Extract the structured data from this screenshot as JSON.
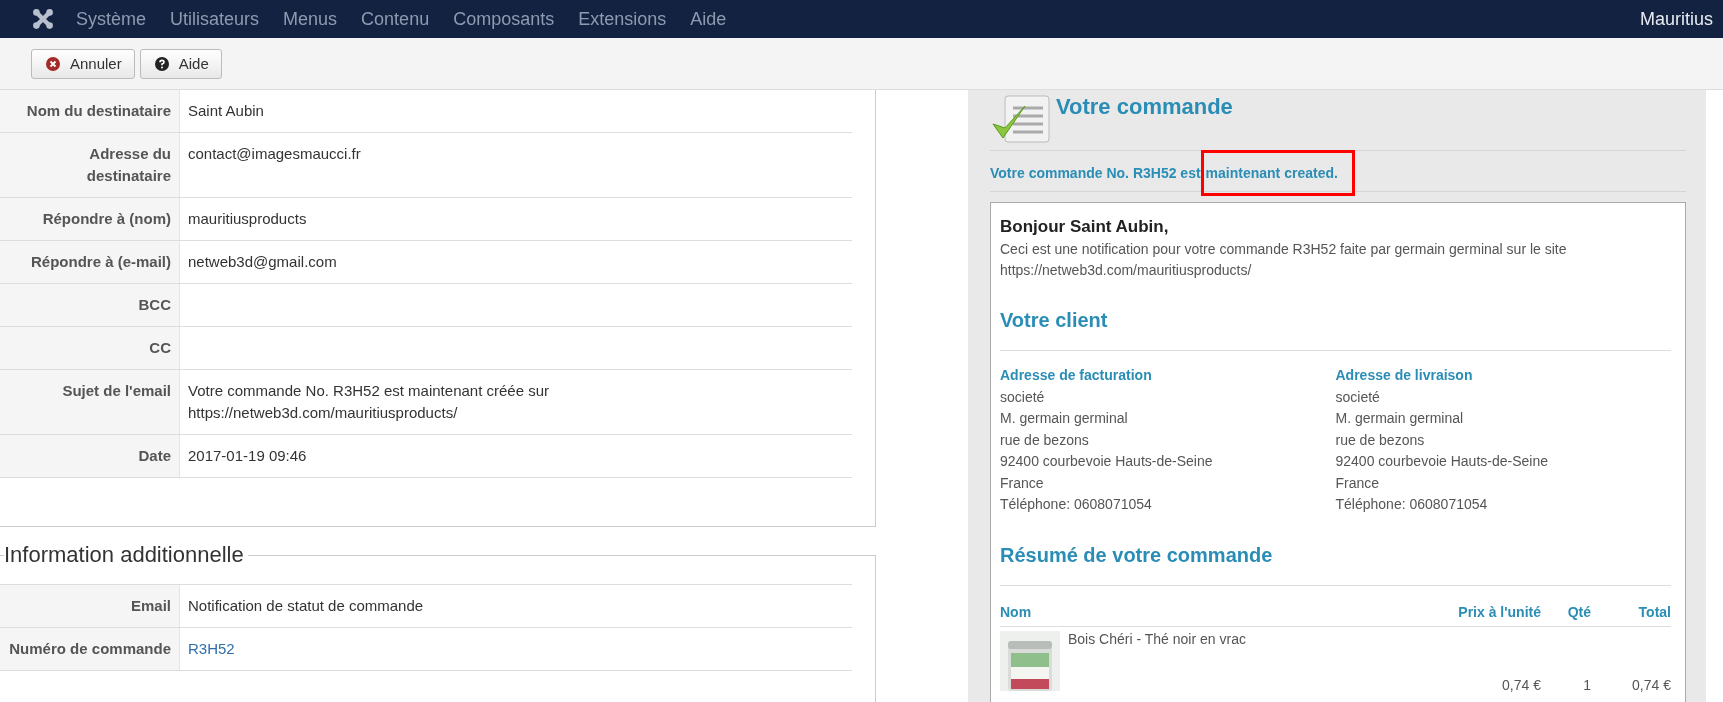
{
  "navbar": {
    "menu": [
      "Système",
      "Utilisateurs",
      "Menus",
      "Contenu",
      "Composants",
      "Extensions",
      "Aide"
    ],
    "site": "Mauritius"
  },
  "toolbar": {
    "buttons": [
      {
        "label": "Annuler",
        "kind": "cancel"
      },
      {
        "label": "Aide",
        "kind": "help"
      }
    ]
  },
  "details": {
    "rows": [
      {
        "label": "Nom du destinataire",
        "value": "Saint Aubin"
      },
      {
        "label": "Adresse du destinataire",
        "value": "contact@imagesmaucci.fr"
      },
      {
        "label": "Répondre à (nom)",
        "value": "mauritiusproducts"
      },
      {
        "label": "Répondre à (e-mail)",
        "value": "netweb3d@gmail.com"
      },
      {
        "label": "BCC"
      },
      {
        "label": "CC"
      },
      {
        "label": "Sujet de l'email",
        "value": "Votre commande No. R3H52 est maintenant créée sur https://netweb3d.com/mauritiusproducts/"
      },
      {
        "label": "Date",
        "value": "2017-01-19 09:46"
      }
    ]
  },
  "additional": {
    "legend": "Information additionnelle",
    "rows": [
      {
        "label": "Email",
        "value": "Notification de statut de commande",
        "kind": "text"
      },
      {
        "label": "Numéro de commande",
        "value": "R3H52",
        "kind": "link"
      }
    ]
  },
  "preview": {
    "title": "Votre commande",
    "message": "Votre commande No. R3H52 est",
    "message_highlighted": "maintenant created.",
    "email": {
      "greeting": "Bonjour Saint Aubin,",
      "intro": "Ceci est une notification pour votre commande R3H52 faite par germain germinal sur le site https://netweb3d.com/mauritiusproducts/",
      "client_heading": "Votre client",
      "addresses": [
        {
          "heading": "Adresse de facturation",
          "lines": [
            "societé",
            "M. germain germinal",
            "rue de bezons",
            "92400 courbevoie Hauts-de-Seine",
            "France",
            "Téléphone: 0608071054"
          ]
        },
        {
          "heading": "Adresse de livraison",
          "lines": [
            "societé",
            "M. germain germinal",
            "rue de bezons",
            "92400 courbevoie Hauts-de-Seine",
            "France",
            "Téléphone: 0608071054"
          ]
        }
      ],
      "summary_heading": "Résumé de votre commande",
      "columns": [
        "Nom",
        "Prix à l'unité",
        "Qté",
        "Total"
      ],
      "items": [
        {
          "kind": "picture",
          "name": "Bois Chéri - Thé noir en vrac",
          "price": "0,74 €",
          "qty": "1",
          "total": "0,74 €"
        }
      ]
    }
  }
}
